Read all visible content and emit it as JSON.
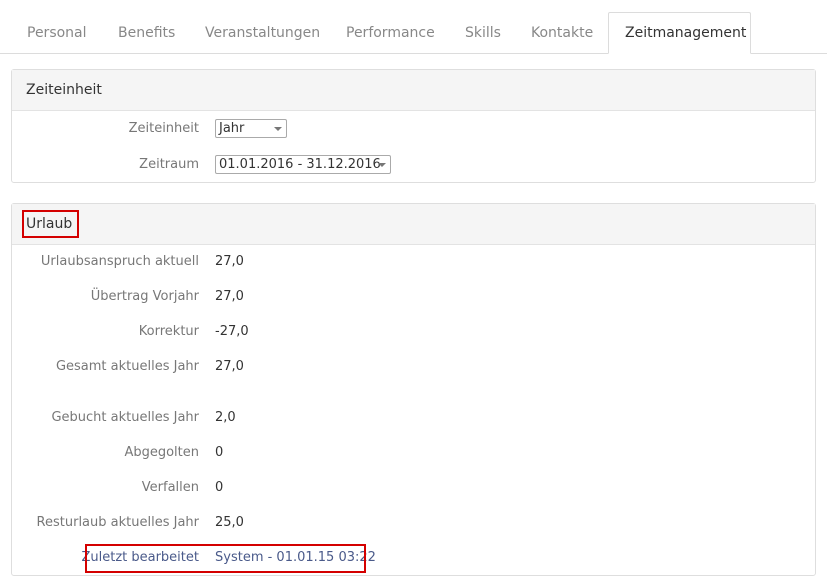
{
  "tabs": [
    {
      "label": "Personal"
    },
    {
      "label": "Benefits"
    },
    {
      "label": "Veranstaltungen"
    },
    {
      "label": "Performance"
    },
    {
      "label": "Skills"
    },
    {
      "label": "Kontakte"
    },
    {
      "label": "Zeitmanagement",
      "active": true
    }
  ],
  "zeiteinheit_panel": {
    "title": "Zeiteinheit",
    "unit_label": "Zeiteinheit",
    "unit_value": "Jahr",
    "range_label": "Zeitraum",
    "range_value": "01.01.2016 - 31.12.2016"
  },
  "urlaub_panel": {
    "title": "Urlaub",
    "rows": [
      {
        "label": "Urlaubsanspruch aktuell",
        "value": "27,0"
      },
      {
        "label": "Übertrag Vorjahr",
        "value": "27,0"
      },
      {
        "label": "Korrektur",
        "value": "-27,0"
      },
      {
        "label": "Gesamt aktuelles Jahr",
        "value": "27,0"
      },
      {
        "label": "Gebucht aktuelles Jahr",
        "value": "2,0"
      },
      {
        "label": "Abgegolten",
        "value": "0"
      },
      {
        "label": "Verfallen",
        "value": "0"
      },
      {
        "label": "Resturlaub aktuelles Jahr",
        "value": "25,0"
      }
    ],
    "last_edited_label": "Zuletzt bearbeitet",
    "last_edited_value": "System - 01.01.15 03:22"
  },
  "colors": {
    "highlight": "#d40000",
    "panel_header_bg": "#f5f5f5",
    "label_text": "#777777"
  }
}
